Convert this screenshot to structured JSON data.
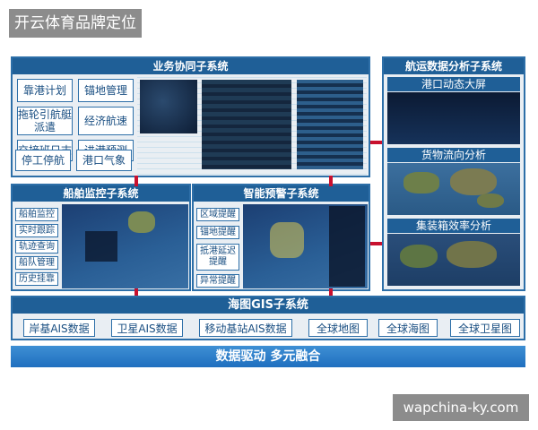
{
  "header_tag": "开云体育品牌定位",
  "footer_tag": "wapchina-ky.com",
  "business": {
    "title": "业务协同子系统",
    "left_items": [
      "靠港计划",
      "拖轮引航艇派遣",
      "交接班日志",
      "停工停航"
    ],
    "right_items": [
      "锚地管理",
      "经济航速",
      "进港预测",
      "港口气象"
    ]
  },
  "ship": {
    "title": "船舶监控子系统",
    "items": [
      "船舶监控",
      "实时跟踪",
      "轨迹查询",
      "船队管理",
      "历史挂靠"
    ]
  },
  "warning": {
    "title": "智能预警子系统",
    "items": [
      "区域提醒",
      "锚地提醒",
      "抵港延迟提醒",
      "异常提醒"
    ]
  },
  "shipping": {
    "title": "航运数据分析子系统",
    "sections": [
      "港口动态大屏",
      "货物流向分析",
      "集装箱效率分析"
    ]
  },
  "gis": {
    "title": "海图GIS子系统",
    "items": [
      "岸基AIS数据",
      "卫星AIS数据",
      "移动基站AIS数据",
      "全球地图",
      "全球海图",
      "全球卫星图"
    ]
  },
  "footer_bar": "数据驱动 多元融合",
  "colors": {
    "panel_border": "#2d6fa8",
    "bar": "#1f5f97",
    "arrow": "#c8102e"
  }
}
